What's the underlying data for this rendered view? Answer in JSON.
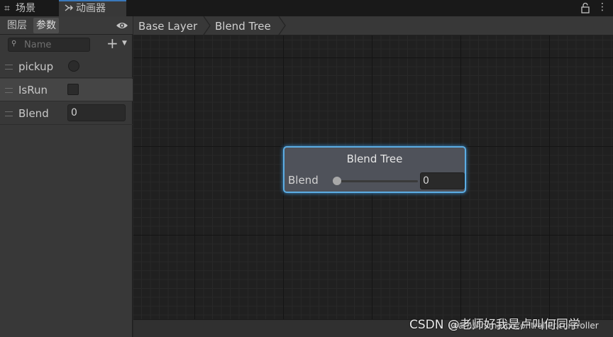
{
  "window_tabs": [
    {
      "label": "场景",
      "icon": "grid-icon"
    },
    {
      "label": "动画器",
      "icon": "animator-icon"
    }
  ],
  "left_panel": {
    "tabs": [
      {
        "label": "图层"
      },
      {
        "label": "参数"
      }
    ],
    "search_placeholder": "Name",
    "parameters": [
      {
        "name": "pickup",
        "type": "trigger"
      },
      {
        "name": "IsRun",
        "type": "bool"
      },
      {
        "name": "Blend",
        "type": "float",
        "value": "0"
      }
    ]
  },
  "breadcrumb": [
    {
      "label": "Base Layer"
    },
    {
      "label": "Blend Tree"
    }
  ],
  "node": {
    "title": "Blend Tree",
    "param_label": "Blend",
    "value": "0",
    "slider_level": 0
  },
  "status": {
    "asset_path": "Learn/AnimatorController.controller"
  },
  "watermark": "CSDN @老师好我是卢叫何同学",
  "colors": {
    "accent": "#3a79bb",
    "node_border": "#5cade3",
    "panel": "#383838",
    "graph": "#202020"
  }
}
